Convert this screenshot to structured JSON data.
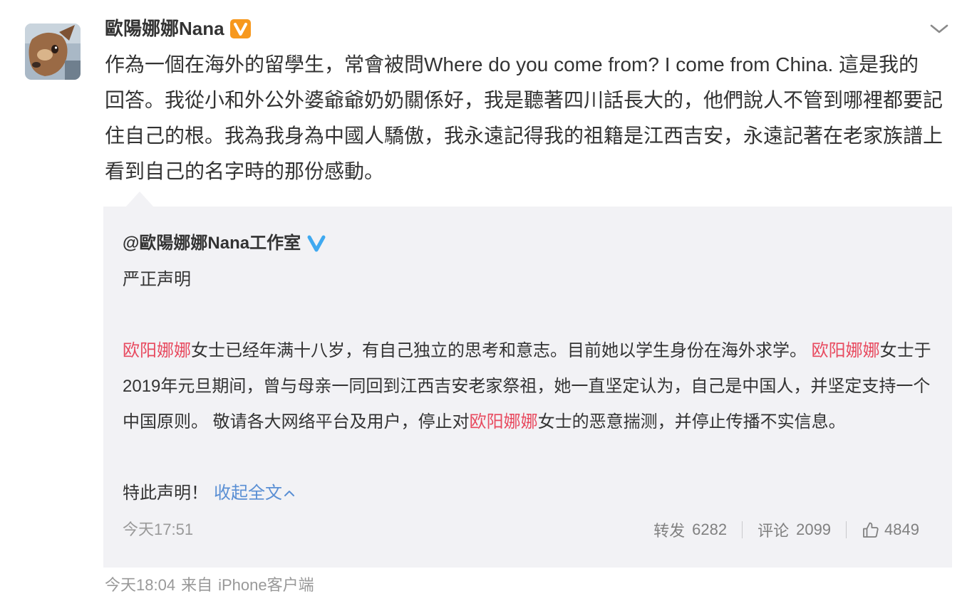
{
  "author": {
    "name": "歐陽娜娜Nana",
    "badge_icon": "verified-orange-v-icon",
    "avatar_icon": "avatar-image"
  },
  "menu_icon": "chevron-down-icon",
  "post": {
    "text_lines": [
      "作為一個在海外的留學生，常會被問Where do you come from? I come from China. 這是我的",
      "回答。我從小和外公外婆爺爺奶奶關係好，我是聽著四川話長大的，他們說人不管到哪裡都要記",
      "住自己的根。我為我身為中國人驕傲，我永遠記得我的祖籍是江西吉安，永遠記著在老家族譜上",
      "看到自己的名字時的那份感動。"
    ],
    "time": "今天18:04",
    "via_label": "来自",
    "client": "iPhone客户端"
  },
  "repost": {
    "author": "@歐陽娜娜Nana工作室",
    "badge_icon": "verified-blue-v-icon",
    "title": "严正声明",
    "body_lines": [
      [
        {
          "text": "欧阳娜娜",
          "highlight": true
        },
        {
          "text": "女士已经年满十八岁，有自己独立的思考和意志。目前她以学生身份在海外求学。 ",
          "highlight": false
        },
        {
          "text": "欧阳娜娜",
          "highlight": true
        },
        {
          "text": "女士于",
          "highlight": false
        }
      ],
      [
        {
          "text": "2019年元旦期间，曾与母亲一同回到江西吉安老家祭祖，她一直坚定认为，自己是中国人，并坚定支持一个",
          "highlight": false
        }
      ],
      [
        {
          "text": "中国原则。 敬请各大网络平台及用户，停止对",
          "highlight": false
        },
        {
          "text": "欧阳娜娜",
          "highlight": true
        },
        {
          "text": "女士的恶意揣测，并停止传播不实信息。",
          "highlight": false
        }
      ]
    ],
    "closing": "特此声明！",
    "collapse_label": "收起全文",
    "collapse_icon": "chevron-up-icon",
    "time": "今天17:51",
    "stats": {
      "repost_label": "转发",
      "repost_count": "6282",
      "comment_label": "评论",
      "comment_count": "2099",
      "like_icon": "thumbs-up-icon",
      "like_count": "4849"
    }
  },
  "colors": {
    "text": "#333333",
    "highlight": "#e84a5f",
    "link": "#5a8fd4",
    "muted": "#999999",
    "stats": "#808080",
    "repost_background": "#f2f2f5",
    "badge_orange": "#f7981d",
    "badge_blue": "#3fa9f0"
  }
}
